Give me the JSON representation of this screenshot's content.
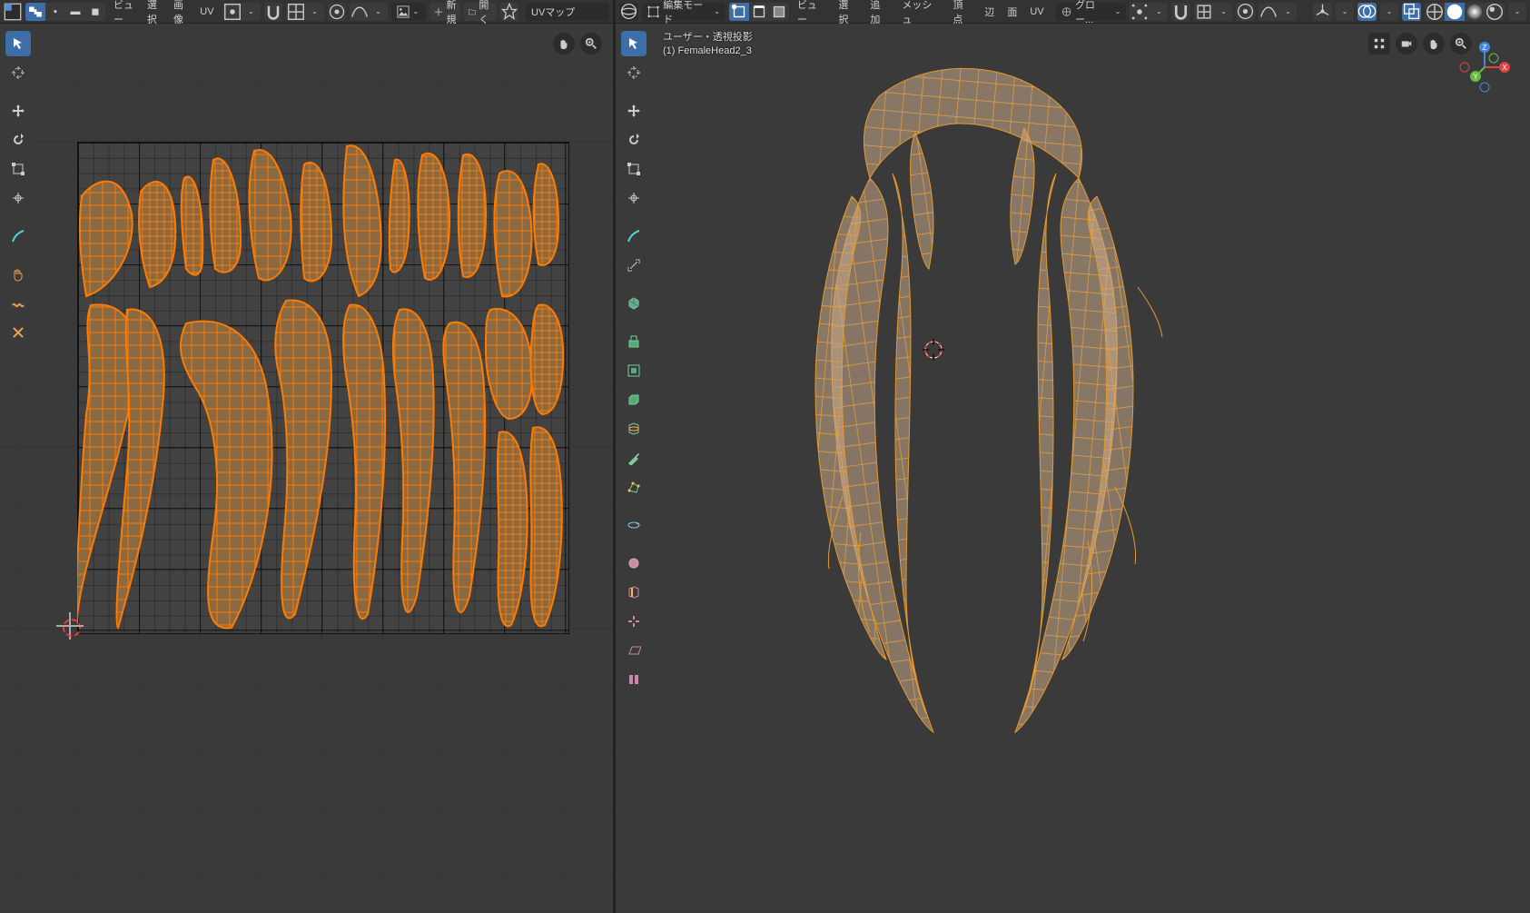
{
  "left_header": {
    "menus": {
      "view": "ビュー",
      "select": "選択",
      "image": "画像",
      "uv": "UV"
    },
    "new": "新規",
    "open": "開く",
    "uvmap_label": "UVマップ"
  },
  "right_header": {
    "mode": "編集モード",
    "menus": {
      "view": "ビュー",
      "select": "選択",
      "add": "追加",
      "mesh": "メッシュ",
      "vertex": "頂点",
      "edge": "辺",
      "face": "面",
      "uv": "UV"
    },
    "transform_orientation": "グロー..."
  },
  "left_tools": {
    "select": "select",
    "cursor": "cursor",
    "move": "move",
    "rotate": "rotate",
    "scale": "scale",
    "transform": "transform",
    "annotate": "annotate",
    "grab": "grab",
    "relax": "relax",
    "pinch": "pinch"
  },
  "right_tools": [
    "select",
    "cursor",
    "move",
    "rotate",
    "scale",
    "transform",
    "annotate",
    "measure",
    "extrude",
    "inset",
    "bevel",
    "loopcut",
    "knife",
    "polybuild",
    "spin",
    "smooth",
    "edge-slide",
    "shrink-fatten",
    "shear",
    "rip"
  ],
  "overlay_icons": {
    "camera": "camera",
    "record": "record",
    "pan": "pan",
    "zoom": "zoom"
  },
  "info": {
    "projection": "ユーザー・透視投影",
    "object": "(1) FemaleHead2_3"
  },
  "axes": {
    "x": "X",
    "y": "Y",
    "z": "Z"
  }
}
